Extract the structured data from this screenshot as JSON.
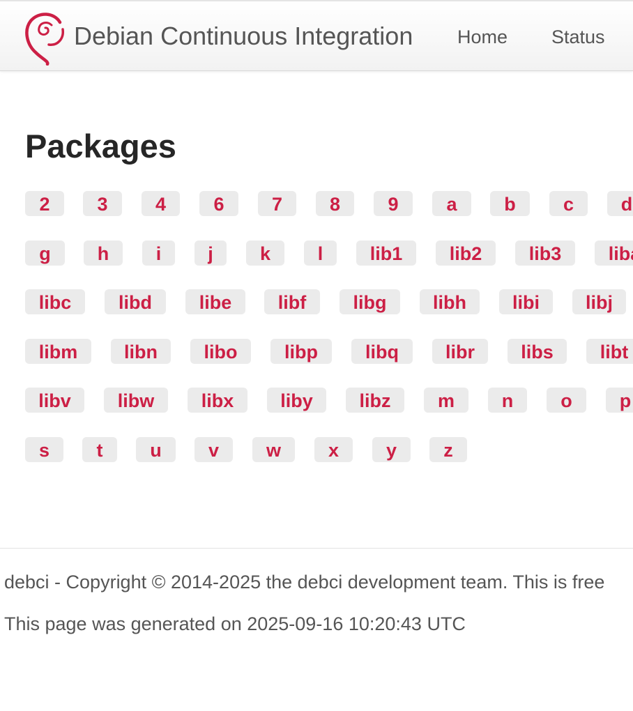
{
  "header": {
    "title": "Debian Continuous Integration",
    "logo_icon": "debian-swirl-icon",
    "nav": [
      {
        "label": "Home"
      },
      {
        "label": "Status"
      }
    ]
  },
  "main": {
    "heading": "Packages",
    "rows": [
      [
        "2",
        "3",
        "4",
        "6",
        "7",
        "8",
        "9",
        "a",
        "b",
        "c",
        "d"
      ],
      [
        "g",
        "h",
        "i",
        "j",
        "k",
        "l",
        "lib1",
        "lib2",
        "lib3",
        "liba"
      ],
      [
        "libc",
        "libd",
        "libe",
        "libf",
        "libg",
        "libh",
        "libi",
        "libj"
      ],
      [
        "libm",
        "libn",
        "libo",
        "libp",
        "libq",
        "libr",
        "libs",
        "libt"
      ],
      [
        "libv",
        "libw",
        "libx",
        "liby",
        "libz",
        "m",
        "n",
        "o",
        "p"
      ],
      [
        "s",
        "t",
        "u",
        "v",
        "w",
        "x",
        "y",
        "z"
      ]
    ]
  },
  "footer": {
    "copyright": "debci - Copyright © 2014-2025 the debci development team. This is free",
    "generated": "This page was generated on 2025-09-16 10:20:43 UTC"
  },
  "colors": {
    "accent": "#cc1f45",
    "badge_bg": "#ebebeb",
    "text": "#555555",
    "heading": "#262626"
  }
}
